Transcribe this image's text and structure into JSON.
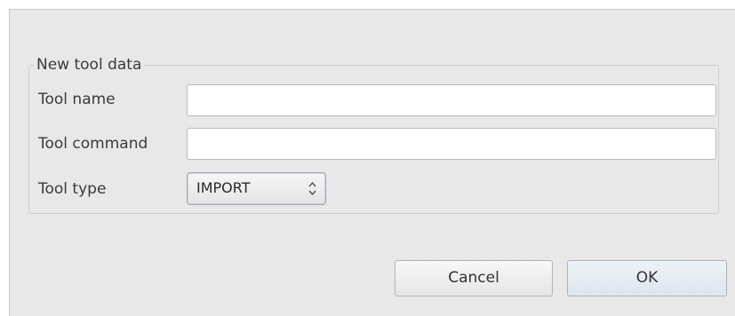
{
  "group": {
    "title": "New tool data"
  },
  "fields": {
    "tool_name": {
      "label": "Tool name",
      "value": "",
      "placeholder": ""
    },
    "tool_command": {
      "label": "Tool command",
      "value": "",
      "placeholder": ""
    },
    "tool_type": {
      "label": "Tool type",
      "selected": "IMPORT",
      "icon": "spinner-updown-icon"
    }
  },
  "buttons": {
    "cancel_label": "Cancel",
    "ok_label": "OK"
  }
}
